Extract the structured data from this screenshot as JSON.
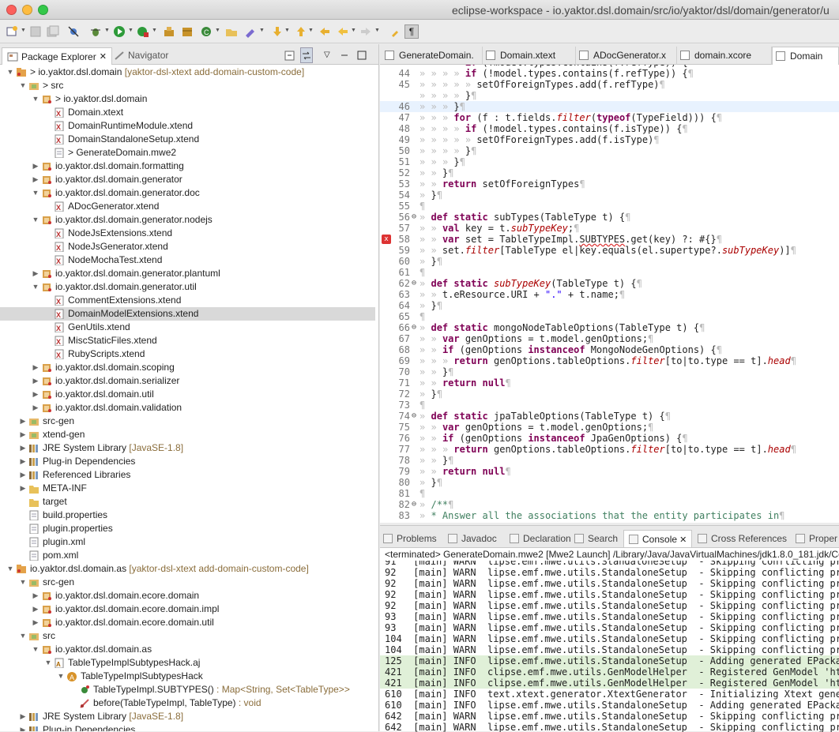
{
  "window": {
    "title": "eclipse-workspace - io.yaktor.dsl.domain/src/io/yaktor/dsl/domain/generator/u"
  },
  "left_tabs": [
    {
      "label": "Package Explorer"
    },
    {
      "label": "Navigator"
    }
  ],
  "tree": [
    {
      "d": 0,
      "tw": "v",
      "ic": "proj",
      "label": "> io.yaktor.dsl.domain",
      "deco": " [yaktor-dsl-xtext add-domain-custom-code]"
    },
    {
      "d": 1,
      "tw": "v",
      "ic": "srcf",
      "label": "> src"
    },
    {
      "d": 2,
      "tw": "v",
      "ic": "pkg",
      "label": "> io.yaktor.dsl.domain"
    },
    {
      "d": 3,
      "tw": "",
      "ic": "xfile",
      "label": "Domain.xtext"
    },
    {
      "d": 3,
      "tw": "",
      "ic": "xfile",
      "label": "DomainRuntimeModule.xtend"
    },
    {
      "d": 3,
      "tw": "",
      "ic": "xfile",
      "label": "DomainStandaloneSetup.xtend"
    },
    {
      "d": 3,
      "tw": "",
      "ic": "file",
      "label": "> GenerateDomain.mwe2"
    },
    {
      "d": 2,
      "tw": ">",
      "ic": "pkg",
      "label": "io.yaktor.dsl.domain.formatting"
    },
    {
      "d": 2,
      "tw": ">",
      "ic": "pkg",
      "label": "io.yaktor.dsl.domain.generator"
    },
    {
      "d": 2,
      "tw": "v",
      "ic": "pkg",
      "label": "io.yaktor.dsl.domain.generator.doc"
    },
    {
      "d": 3,
      "tw": "",
      "ic": "xfile",
      "label": "ADocGenerator.xtend"
    },
    {
      "d": 2,
      "tw": "v",
      "ic": "pkg",
      "label": "io.yaktor.dsl.domain.generator.nodejs"
    },
    {
      "d": 3,
      "tw": "",
      "ic": "xfile",
      "label": "NodeJsExtensions.xtend"
    },
    {
      "d": 3,
      "tw": "",
      "ic": "xfile",
      "label": "NodeJsGenerator.xtend"
    },
    {
      "d": 3,
      "tw": "",
      "ic": "xfile",
      "label": "NodeMochaTest.xtend"
    },
    {
      "d": 2,
      "tw": ">",
      "ic": "pkg",
      "label": "io.yaktor.dsl.domain.generator.plantuml"
    },
    {
      "d": 2,
      "tw": "v",
      "ic": "pkg",
      "label": "io.yaktor.dsl.domain.generator.util"
    },
    {
      "d": 3,
      "tw": "",
      "ic": "xfile",
      "label": "CommentExtensions.xtend"
    },
    {
      "d": 3,
      "tw": "",
      "ic": "xfile",
      "label": "DomainModelExtensions.xtend",
      "sel": true
    },
    {
      "d": 3,
      "tw": "",
      "ic": "xfile",
      "label": "GenUtils.xtend"
    },
    {
      "d": 3,
      "tw": "",
      "ic": "xfile",
      "label": "MiscStaticFiles.xtend"
    },
    {
      "d": 3,
      "tw": "",
      "ic": "xfile",
      "label": "RubyScripts.xtend"
    },
    {
      "d": 2,
      "tw": ">",
      "ic": "pkg",
      "label": "io.yaktor.dsl.domain.scoping"
    },
    {
      "d": 2,
      "tw": ">",
      "ic": "pkg",
      "label": "io.yaktor.dsl.domain.serializer"
    },
    {
      "d": 2,
      "tw": ">",
      "ic": "pkg",
      "label": "io.yaktor.dsl.domain.util"
    },
    {
      "d": 2,
      "tw": ">",
      "ic": "pkg",
      "label": "io.yaktor.dsl.domain.validation"
    },
    {
      "d": 1,
      "tw": ">",
      "ic": "srcf",
      "label": "src-gen"
    },
    {
      "d": 1,
      "tw": ">",
      "ic": "srcf",
      "label": "xtend-gen"
    },
    {
      "d": 1,
      "tw": ">",
      "ic": "lib",
      "label": "JRE System Library",
      "deco": " [JavaSE-1.8]"
    },
    {
      "d": 1,
      "tw": ">",
      "ic": "lib",
      "label": "Plug-in Dependencies"
    },
    {
      "d": 1,
      "tw": ">",
      "ic": "lib",
      "label": "Referenced Libraries"
    },
    {
      "d": 1,
      "tw": ">",
      "ic": "folder",
      "label": "META-INF"
    },
    {
      "d": 1,
      "tw": "",
      "ic": "folder",
      "label": "target"
    },
    {
      "d": 1,
      "tw": "",
      "ic": "file",
      "label": "build.properties"
    },
    {
      "d": 1,
      "tw": "",
      "ic": "file",
      "label": "plugin.properties"
    },
    {
      "d": 1,
      "tw": "",
      "ic": "file",
      "label": "plugin.xml"
    },
    {
      "d": 1,
      "tw": "",
      "ic": "file",
      "label": "pom.xml"
    },
    {
      "d": 0,
      "tw": "v",
      "ic": "proj",
      "label": "io.yaktor.dsl.domain.as",
      "deco": " [yaktor-dsl-xtext add-domain-custom-code]"
    },
    {
      "d": 1,
      "tw": "v",
      "ic": "srcf",
      "label": "src-gen"
    },
    {
      "d": 2,
      "tw": ">",
      "ic": "pkg",
      "label": "io.yaktor.dsl.domain.ecore.domain"
    },
    {
      "d": 2,
      "tw": ">",
      "ic": "pkg",
      "label": "io.yaktor.dsl.domain.ecore.domain.impl"
    },
    {
      "d": 2,
      "tw": ">",
      "ic": "pkg",
      "label": "io.yaktor.dsl.domain.ecore.domain.util"
    },
    {
      "d": 1,
      "tw": "v",
      "ic": "srcf",
      "label": "src"
    },
    {
      "d": 2,
      "tw": "v",
      "ic": "pkg",
      "label": "io.yaktor.dsl.domain.as"
    },
    {
      "d": 3,
      "tw": "v",
      "ic": "aj",
      "label": "TableTypeImplSubtypesHack.aj"
    },
    {
      "d": 4,
      "tw": "v",
      "ic": "aspect",
      "label": "TableTypeImplSubtypesHack"
    },
    {
      "d": 5,
      "tw": "",
      "ic": "method",
      "label": "TableTypeImpl.SUBTYPES()",
      "deco": " : Map<String, Set<TableType>>"
    },
    {
      "d": 5,
      "tw": "",
      "ic": "advice",
      "label": "before(TableTypeImpl, TableType)",
      "deco": " : void"
    },
    {
      "d": 1,
      "tw": ">",
      "ic": "lib",
      "label": "JRE System Library",
      "deco": " [JavaSE-1.8]"
    },
    {
      "d": 1,
      "tw": ">",
      "ic": "lib",
      "label": "Plug-in Dependencies"
    }
  ],
  "editor_tabs": [
    {
      "label": "GenerateDomain."
    },
    {
      "label": "Domain.xtext"
    },
    {
      "label": "ADocGenerator.x"
    },
    {
      "label": "domain.xcore"
    },
    {
      "label": "Domain",
      "active": true
    }
  ],
  "code": [
    {
      "n": "",
      "t": "» » » » if (!model.types.contains(f.refType)) {"
    },
    {
      "n": "44",
      "t": "» » » » if (!model.types.contains(f.refType)) {¶"
    },
    {
      "n": "45",
      "t": "» » » » » setOfForeignTypes.add(f.refType)¶"
    },
    {
      "n": "46",
      "t": "» » » » }¶"
    },
    {
      "n": "46b",
      "t": "» » » }¶"
    },
    {
      "n": "47",
      "t": "» » » for (f : t.fields.filter(typeof(TypeField))) {¶"
    },
    {
      "n": "48",
      "t": "» » » » if (!model.types.contains(f.isType)) {¶"
    },
    {
      "n": "49",
      "t": "» » » » » setOfForeignTypes.add(f.isType)¶"
    },
    {
      "n": "50",
      "t": "» » » » }¶"
    },
    {
      "n": "51",
      "t": "» » » }¶"
    },
    {
      "n": "52",
      "t": "» » }¶"
    },
    {
      "n": "53",
      "t": "» » return setOfForeignTypes¶"
    },
    {
      "n": "54",
      "t": "» }¶"
    },
    {
      "n": "55",
      "t": "¶"
    },
    {
      "n": "56",
      "t": "» def static subTypes(TableType t) {¶"
    },
    {
      "n": "57",
      "t": "» » val key = t.subTypeKey;¶"
    },
    {
      "n": "58",
      "t": "» » var set = TableTypeImpl.SUBTYPES.get(key) ?: #{}¶"
    },
    {
      "n": "59",
      "t": "» » set.filter[TableType el|key.equals(el.supertype?.subTypeKey)]¶"
    },
    {
      "n": "60",
      "t": "» }¶"
    },
    {
      "n": "61",
      "t": "¶"
    },
    {
      "n": "62",
      "t": "» def static subTypeKey(TableType t) {¶"
    },
    {
      "n": "63",
      "t": "» » t.eResource.URI + \".\" + t.name;¶"
    },
    {
      "n": "64",
      "t": "» }¶"
    },
    {
      "n": "65",
      "t": "¶"
    },
    {
      "n": "66",
      "t": "» def static mongoNodeTableOptions(TableType t) {¶"
    },
    {
      "n": "67",
      "t": "» » var genOptions = t.model.genOptions;¶"
    },
    {
      "n": "68",
      "t": "» » if (genOptions instanceof MongoNodeGenOptions) {¶"
    },
    {
      "n": "69",
      "t": "» » » return genOptions.tableOptions.filter[to|to.type == t].head¶"
    },
    {
      "n": "70",
      "t": "» » }¶"
    },
    {
      "n": "71",
      "t": "» » return null¶"
    },
    {
      "n": "72",
      "t": "» }¶"
    },
    {
      "n": "73",
      "t": "¶"
    },
    {
      "n": "74",
      "t": "» def static jpaTableOptions(TableType t) {¶"
    },
    {
      "n": "75",
      "t": "» » var genOptions = t.model.genOptions;¶"
    },
    {
      "n": "76",
      "t": "» » if (genOptions instanceof JpaGenOptions) {¶"
    },
    {
      "n": "77",
      "t": "» » » return genOptions.tableOptions.filter[to|to.type == t].head¶"
    },
    {
      "n": "78",
      "t": "» » }¶"
    },
    {
      "n": "79",
      "t": "» » return null¶"
    },
    {
      "n": "80",
      "t": "» }¶"
    },
    {
      "n": "81",
      "t": "¶"
    },
    {
      "n": "82",
      "t": "» /**¶"
    },
    {
      "n": "83",
      "t": "» * Answer all the associations that the entity participates in¶"
    },
    {
      "n": "84",
      "t": "» */¶"
    }
  ],
  "console_tabs": [
    {
      "label": "Problems"
    },
    {
      "label": "Javadoc"
    },
    {
      "label": "Declaration"
    },
    {
      "label": "Search"
    },
    {
      "label": "Console",
      "active": true
    },
    {
      "label": "Cross References"
    },
    {
      "label": "Proper"
    }
  ],
  "console_header": "<terminated> GenerateDomain.mwe2 [Mwe2 Launch] /Library/Java/JavaVirtualMachines/jdk1.8.0_181.jdk/Co",
  "console_lines": [
    {
      "t": "91   [main] WARN  lipse.emf.mwe.utils.StandaloneSetup  - Skipping conflicting pr"
    },
    {
      "t": "92   [main] WARN  lipse.emf.mwe.utils.StandaloneSetup  - Skipping conflicting pr"
    },
    {
      "t": "92   [main] WARN  lipse.emf.mwe.utils.StandaloneSetup  - Skipping conflicting pr"
    },
    {
      "t": "92   [main] WARN  lipse.emf.mwe.utils.StandaloneSetup  - Skipping conflicting pr"
    },
    {
      "t": "92   [main] WARN  lipse.emf.mwe.utils.StandaloneSetup  - Skipping conflicting pr"
    },
    {
      "t": "93   [main] WARN  lipse.emf.mwe.utils.StandaloneSetup  - Skipping conflicting pr"
    },
    {
      "t": "93   [main] WARN  lipse.emf.mwe.utils.StandaloneSetup  - Skipping conflicting pr"
    },
    {
      "t": "104  [main] WARN  lipse.emf.mwe.utils.StandaloneSetup  - Skipping conflicting pr"
    },
    {
      "t": "104  [main] WARN  lipse.emf.mwe.utils.StandaloneSetup  - Skipping conflicting pr"
    },
    {
      "t": "125  [main] INFO  lipse.emf.mwe.utils.StandaloneSetup  - Adding generated EPacka",
      "info": true
    },
    {
      "t": "421  [main] INFO  clipse.emf.mwe.utils.GenModelHelper  - Registered GenModel 'ht",
      "info": true
    },
    {
      "t": "421  [main] INFO  clipse.emf.mwe.utils.GenModelHelper  - Registered GenModel 'ht",
      "info": true
    },
    {
      "t": "610  [main] INFO  text.xtext.generator.XtextGenerator  - Initializing Xtext gene"
    },
    {
      "t": "610  [main] INFO  lipse.emf.mwe.utils.StandaloneSetup  - Adding generated EPacka"
    },
    {
      "t": "642  [main] WARN  lipse.emf.mwe.utils.StandaloneSetup  - Skipping conflicting pr"
    },
    {
      "t": "642  [main] WARN  lipse.emf.mwe.utils.StandaloneSetup  - Skipping conflicting pr"
    },
    {
      "t": "643  [main] WARN  lipse.emf.mwe.utils.StandaloneSetup  - Skipping conflicting pr"
    }
  ],
  "colors": {
    "keyword": "#7f0055",
    "error": "#d33333",
    "info_bg": "#e0f0d8",
    "selection": "#d9d9d9"
  }
}
